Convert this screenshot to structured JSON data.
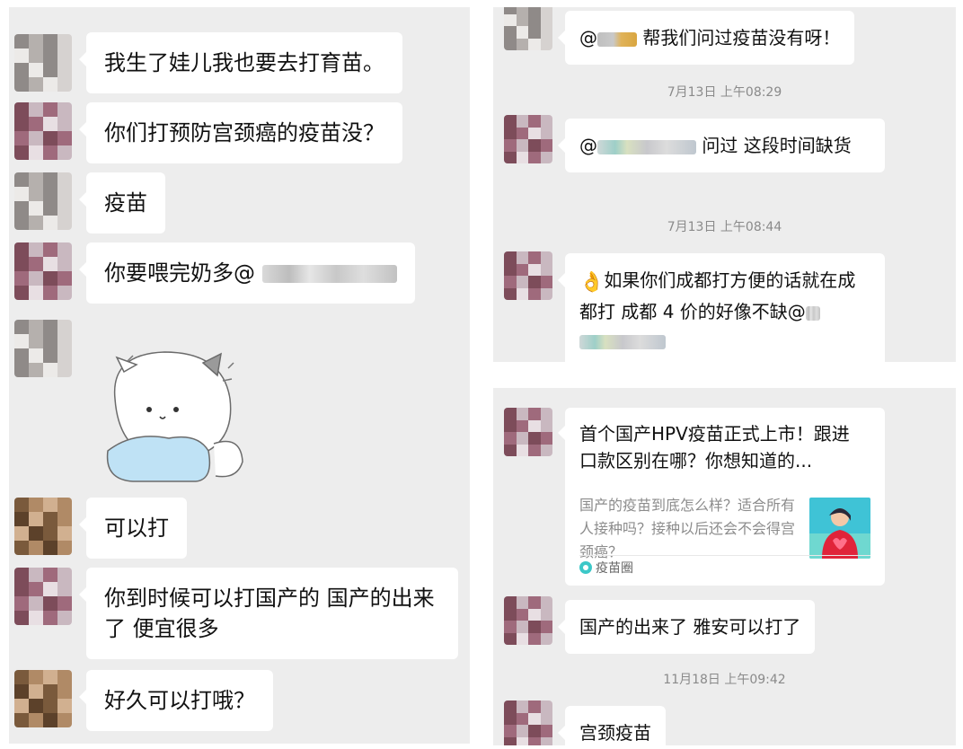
{
  "left_chat": {
    "messages": [
      {
        "text": "我生了娃儿我也要去打育苗。"
      },
      {
        "text": "你们打预防宫颈癌的疫苗没？"
      },
      {
        "text": "疫苗"
      },
      {
        "text": "你要喂完奶多@"
      },
      {
        "text": "可以打"
      },
      {
        "text": "你到时候可以打国产的  国产的出来了  便宜很多"
      },
      {
        "text": "好久可以打哦？"
      }
    ],
    "sticker_name": "cat-sticker"
  },
  "right_top_chat": {
    "msg1": "@",
    "msg1_tail": "帮我们问过疫苗没有呀！",
    "time1": "7月13日 上午08:29",
    "msg2_prefix": "@",
    "msg2_tail": " 问过  这段时间缺货",
    "time2": "7月13日 上午08:44",
    "msg3_emoji": "👌",
    "msg3": "如果你们成都打方便的话就在成都打  成都 4 价的好像不缺@"
  },
  "right_bottom_chat": {
    "card": {
      "title": "首个国产HPV疫苗正式上市！跟进口款区别在哪？你想知道的...",
      "description": "国产的疫苗到底怎么样？适合所有人接种吗？接种以后还会不会得宫颈癌？",
      "source": "疫苗圈"
    },
    "msg1": "国产的出来了  雅安可以打了",
    "time1": "11月18日 上午09:42",
    "msg2": "宫颈疫苗"
  }
}
